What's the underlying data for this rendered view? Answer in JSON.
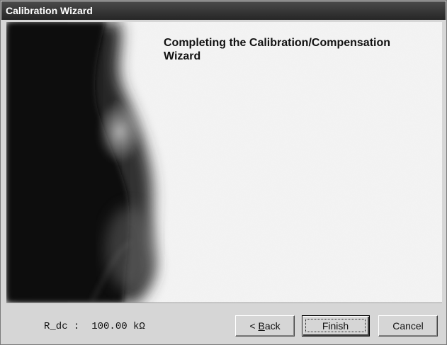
{
  "window": {
    "title": "Calibration Wizard"
  },
  "main": {
    "heading": "Completing the Calibration/Compensation\nWizard"
  },
  "footer": {
    "readout": "R_dc :  100.00 kΩ",
    "buttons": {
      "back": {
        "prefix": "< ",
        "mnemonic": "B",
        "rest": "ack"
      },
      "finish": "Finish",
      "cancel": "Cancel"
    }
  },
  "colors": {
    "titlebar": "#262626",
    "panel_background": "#f3f3f3",
    "dialog_background": "#d6d6d6"
  }
}
